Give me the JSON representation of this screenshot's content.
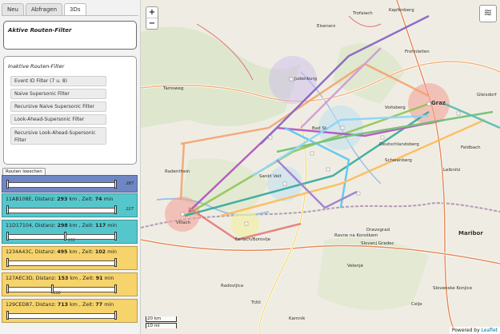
{
  "tabs": [
    {
      "label": "Neu"
    },
    {
      "label": "Abfragen"
    },
    {
      "label": "3Ds"
    }
  ],
  "active_filters_title": "Aktive Routen-Filter",
  "inactive_filters_title": "Inaktive Routen-Filter",
  "filters": [
    "Event ID Filter (7 u. 8)",
    "Naive Supersonic Filter",
    "Recursive Naive Supersonic Filter",
    "Look-Ahead-Supersonic Filter",
    "Recursive Look-Ahead-Supersonic Filter"
  ],
  "clear_routes_label": "Routen loeschen",
  "routes": [
    {
      "color": "#6f86c4",
      "id": "",
      "dist_label": "",
      "dist": "",
      "time_label": "",
      "time": "",
      "unit": "",
      "handle_end": "287",
      "handle_mid": ""
    },
    {
      "color": "#55c7cc",
      "id": "11AB108E",
      "dist_label": "Distanz:",
      "dist": "293",
      "time_label": "Zeit:",
      "time": "74",
      "unit": "min",
      "handle_end": "227",
      "handle_mid": ""
    },
    {
      "color": "#55c7cc",
      "id": "11D17104",
      "dist_label": "Distanz:",
      "dist": "298",
      "time_label": "Zeit:",
      "time": "117",
      "unit": "min",
      "handle_end": "",
      "handle_mid": "153"
    },
    {
      "color": "#f6d36b",
      "id": "1234A43C",
      "dist_label": "Distanz:",
      "dist": "495",
      "time_label": "Zeit:",
      "time": "102",
      "unit": "min",
      "handle_end": "",
      "handle_mid": ""
    },
    {
      "color": "#f6d36b",
      "id": "127AEC3D",
      "dist_label": "Distanz:",
      "dist": "153",
      "time_label": "Zeit:",
      "time": "91",
      "unit": "min",
      "handle_end": "",
      "handle_mid": "100"
    },
    {
      "color": "#f6d36b",
      "id": "129CED87",
      "dist_label": "Distanz:",
      "dist": "713",
      "time_label": "Zeit:",
      "time": "77",
      "unit": "min",
      "handle_end": "",
      "handle_mid": ""
    }
  ],
  "map": {
    "zoom_in": "+",
    "zoom_out": "−",
    "scale_km": "20 km",
    "scale_mi": "10 mi",
    "attribution_prefix": "Powered by",
    "attribution_link": "Leaflet",
    "places": [
      "Trofaiach",
      "Kapfenberg",
      "Eisenerz",
      "Frohnleiten",
      "Judenburg",
      "Tamsweg",
      "Voitsberg",
      "Graz",
      "Gleisdorf",
      "Bad St.",
      "Feldbach",
      "Deutschlandsberg",
      "Schwanberg",
      "Leibnitz",
      "Radenthein",
      "Sankt Veit",
      "Villach",
      "Ferlach/Borovlje",
      "Ravne na Koroškem",
      "Slovenj Gradec",
      "Dravograd",
      "Maribor",
      "Velenje",
      "Radovljica",
      "Tržič",
      "Slovenske Konjice",
      "Celje",
      "Kamnik"
    ]
  }
}
